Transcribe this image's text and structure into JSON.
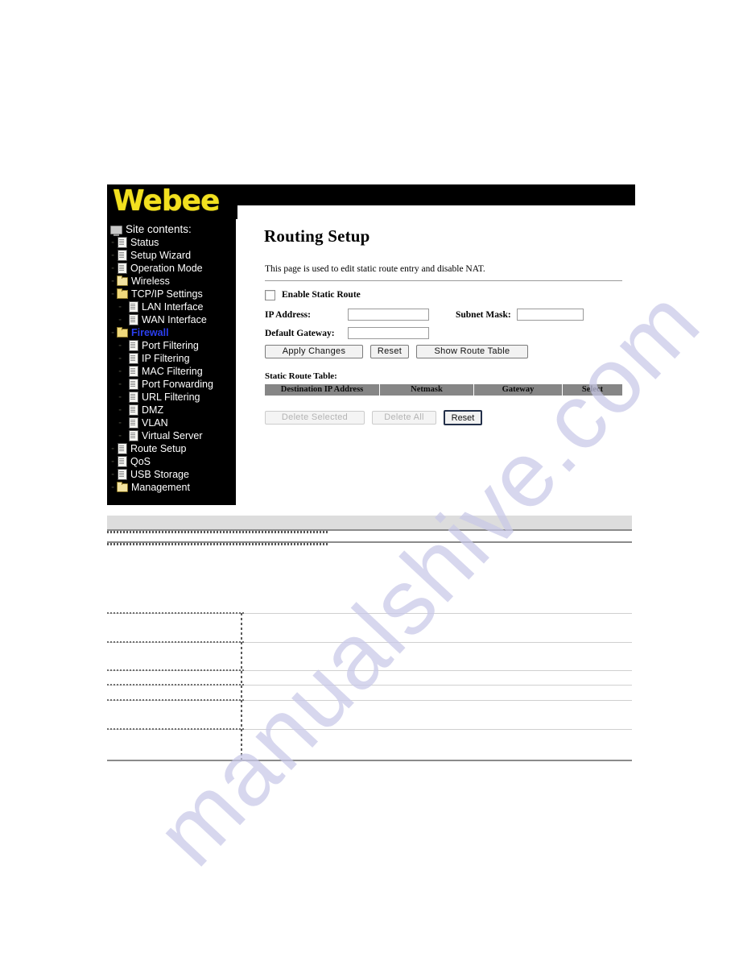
{
  "watermark": {
    "text": "manualshive.com",
    "color": "#c9c9e8"
  },
  "brand": {
    "logo_text": "Webee",
    "logo_color": "#f2e01f",
    "banner_color": "#000000"
  },
  "sidebar": {
    "root_label": "Site contents:",
    "root_icon": "monitor-icon",
    "items": [
      {
        "label": "Status",
        "icon": "page-icon",
        "indent": 0,
        "selected": false
      },
      {
        "label": "Setup Wizard",
        "icon": "page-icon",
        "indent": 0,
        "selected": false
      },
      {
        "label": "Operation Mode",
        "icon": "page-icon",
        "indent": 0,
        "selected": false
      },
      {
        "label": "Wireless",
        "icon": "folder-icon",
        "indent": 0,
        "selected": false
      },
      {
        "label": "TCP/IP Settings",
        "icon": "folder-open-icon",
        "indent": 0,
        "selected": false
      },
      {
        "label": "LAN Interface",
        "icon": "page-icon",
        "indent": 1,
        "selected": false
      },
      {
        "label": "WAN Interface",
        "icon": "page-icon",
        "indent": 1,
        "selected": false
      },
      {
        "label": "Firewall",
        "icon": "folder-open-icon",
        "indent": 0,
        "selected": true
      },
      {
        "label": "Port Filtering",
        "icon": "page-icon",
        "indent": 1,
        "selected": false
      },
      {
        "label": "IP Filtering",
        "icon": "page-icon",
        "indent": 1,
        "selected": false
      },
      {
        "label": "MAC Filtering",
        "icon": "page-icon",
        "indent": 1,
        "selected": false
      },
      {
        "label": "Port Forwarding",
        "icon": "page-icon",
        "indent": 1,
        "selected": false
      },
      {
        "label": "URL Filtering",
        "icon": "page-icon",
        "indent": 1,
        "selected": false
      },
      {
        "label": "DMZ",
        "icon": "page-icon",
        "indent": 1,
        "selected": false
      },
      {
        "label": "VLAN",
        "icon": "page-icon",
        "indent": 1,
        "selected": false
      },
      {
        "label": "Virtual Server",
        "icon": "page-icon",
        "indent": 1,
        "selected": false
      },
      {
        "label": "Route Setup",
        "icon": "page-icon",
        "indent": 0,
        "selected": false
      },
      {
        "label": "QoS",
        "icon": "page-icon",
        "indent": 0,
        "selected": false
      },
      {
        "label": "USB Storage",
        "icon": "page-icon",
        "indent": 0,
        "selected": false
      },
      {
        "label": "Management",
        "icon": "folder-icon",
        "indent": 0,
        "selected": false
      }
    ],
    "selected_color": "#2b3ff0"
  },
  "main": {
    "title": "Routing Setup",
    "description": "This page is used to edit static route entry and disable NAT.",
    "enable_static_route_label": "Enable Static Route",
    "enable_static_route_checked": false,
    "fields": {
      "ip_address_label": "IP Address:",
      "ip_address_value": "",
      "subnet_mask_label": "Subnet Mask:",
      "subnet_mask_value": "",
      "default_gateway_label": "Default Gateway:",
      "default_gateway_value": ""
    },
    "buttons": {
      "apply_changes": "Apply Changes",
      "reset": "Reset",
      "show_route_table": "Show Route Table"
    },
    "table": {
      "caption": "Static Route Table:",
      "headers": [
        "Destination IP Address",
        "Netmask",
        "Gateway",
        "Select"
      ],
      "rows": [],
      "header_bg": "#868686"
    },
    "table_buttons": {
      "delete_selected": "Delete Selected",
      "delete_selected_disabled": true,
      "delete_all": "Delete All",
      "delete_all_disabled": true,
      "reset": "Reset",
      "reset_disabled": false
    }
  }
}
